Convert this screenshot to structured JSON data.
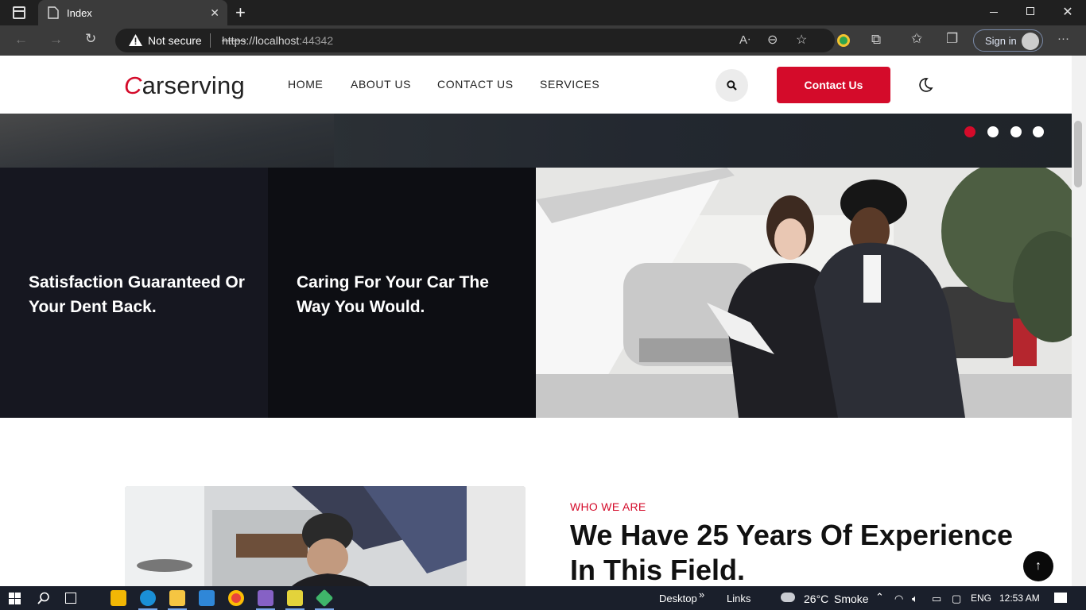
{
  "browser": {
    "tab_title": "Index",
    "tab_close": "✕",
    "new_tab": "+",
    "not_secure": "Not secure",
    "url_scheme": "https",
    "url_rest": "://localhost",
    "url_port": ":44342",
    "sign_in": "Sign in",
    "more": "···"
  },
  "site": {
    "logo_initial": "C",
    "logo_rest": "arserving",
    "menu": [
      "HOME",
      "ABOUT US",
      "CONTACT US",
      "SERVICES"
    ],
    "cta": "Contact Us",
    "slider_active_index": 0
  },
  "features": [
    {
      "title": "Satisfaction Guaranteed Or Your Dent Back."
    },
    {
      "title": "Caring For Your Car The Way You Would."
    }
  ],
  "about": {
    "eyebrow": "WHO WE ARE",
    "headline": "We Have 25 Years Of Experience In This Field."
  },
  "back_to_top": "↑",
  "taskbar": {
    "desktop": "Desktop",
    "links": "Links",
    "temperature": "26°C",
    "weather": "Smoke",
    "language": "ENG",
    "time": "12:53 AM"
  },
  "colors": {
    "brand_red": "#d40b2a",
    "dark_panel": "#161720"
  }
}
